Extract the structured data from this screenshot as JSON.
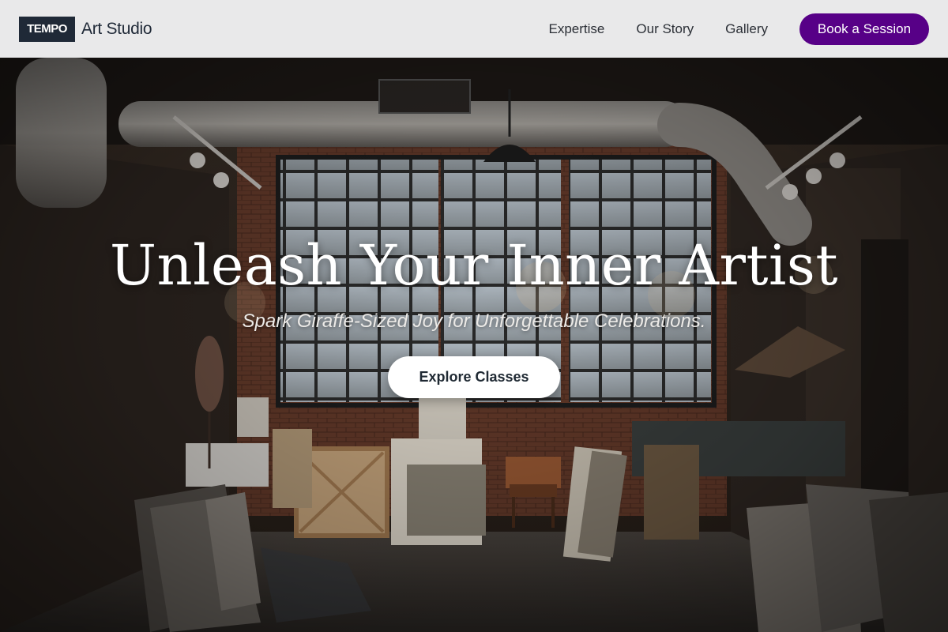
{
  "header": {
    "logo_badge": "TEMPO",
    "logo_text": "Art Studio",
    "nav": [
      {
        "label": "Expertise"
      },
      {
        "label": "Our Story"
      },
      {
        "label": "Gallery"
      }
    ],
    "cta_label": "Book a Session"
  },
  "hero": {
    "title": "Unleash Your Inner Artist",
    "subtitle": "Spark Giraffe-Sized Joy for Unforgettable Celebrations.",
    "button_label": "Explore Classes",
    "background_image": "art-studio-loft-photo"
  },
  "colors": {
    "header_bg": "#e9e9ea",
    "logo_badge_bg": "#1f2937",
    "accent": "#570087",
    "hero_button_bg": "#ffffff"
  }
}
